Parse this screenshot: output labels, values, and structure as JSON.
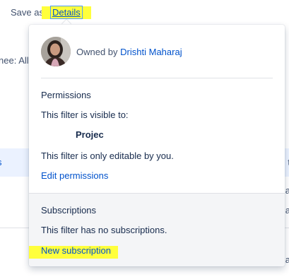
{
  "header": {
    "save_as_label": "Save as",
    "details_label": "Details"
  },
  "background": {
    "assignee_text": "nee: All",
    "row_left_glyph": "s",
    "row_right_glyphs": [
      "t",
      "a",
      "a",
      "a"
    ]
  },
  "popup": {
    "owner": {
      "prefix": "Owned by",
      "name": "Drishti Maharaj"
    },
    "permissions": {
      "heading": "Permissions",
      "visible_to_label": "This filter is visible to:",
      "project": "Projec",
      "editable_text": "This filter is only editable by you.",
      "edit_link": "Edit permissions"
    },
    "subscriptions": {
      "heading": "Subscriptions",
      "none_text": "This filter has no subscriptions.",
      "new_link": "New subscription"
    }
  },
  "colors": {
    "link": "#0052cc",
    "highlight": "#ffff3c",
    "text": "#172b4d",
    "muted": "#42526e"
  },
  "icons": {
    "avatar": "user-avatar-photo"
  }
}
